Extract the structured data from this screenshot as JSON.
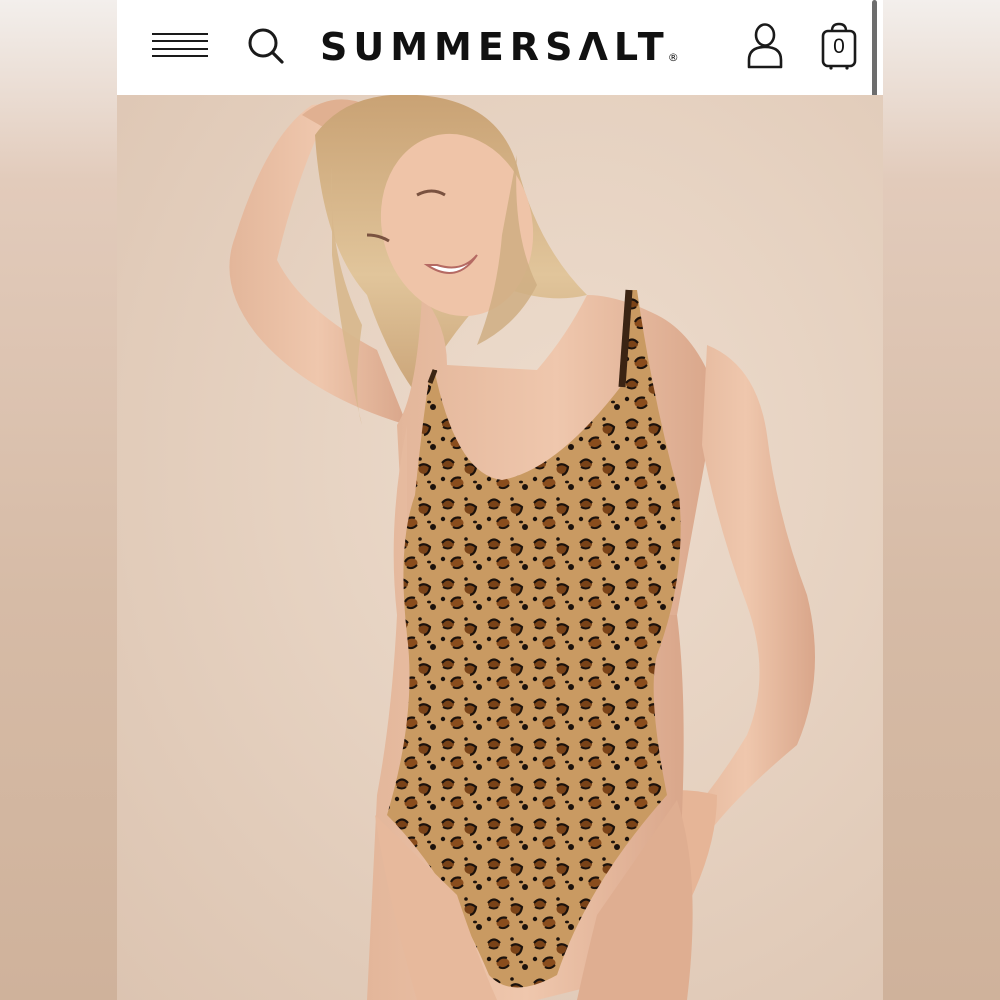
{
  "header": {
    "brand": "SUMMERSΛLT",
    "registered_mark": "®",
    "cart_count": "0"
  },
  "icons": {
    "menu": "hamburger-menu-icon",
    "search": "search-icon",
    "account": "user-icon",
    "cart": "shopping-bag-icon"
  },
  "colors": {
    "header_bg": "#ffffff",
    "text": "#111111",
    "hero_bg": "#e6d2c1"
  }
}
